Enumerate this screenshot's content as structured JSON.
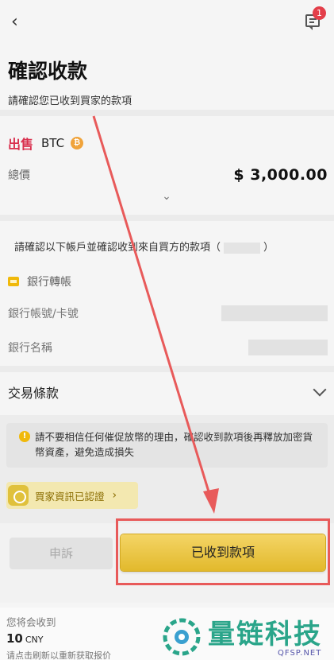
{
  "header": {
    "title": "確認收款",
    "subtitle": "請確認您已收到買家的款項",
    "notification_count": "1"
  },
  "order": {
    "side_label": "出售",
    "coin": "BTC",
    "coin_icon_glyph": "₿",
    "total_label": "總價",
    "total_value": "$ 3,000.00"
  },
  "payment": {
    "confirm_prefix": "請確認以下帳戶並確認收到來自買方的款項（",
    "confirm_suffix": "）",
    "method": "銀行轉帳",
    "fields": [
      {
        "label": "銀行帳號/卡號"
      },
      {
        "label": "銀行名稱"
      }
    ]
  },
  "terms": {
    "label": "交易條款"
  },
  "notice": {
    "text": "請不要相信任何催促放幣的理由，確認收到款項後再釋放加密貨幣資產，避免造成損失",
    "icon": "warning-icon"
  },
  "verified": {
    "label": "買家資訊已認證",
    "chevron": "›"
  },
  "actions": {
    "appeal_label": "申訴",
    "received_label": "已收到款項"
  },
  "footer": {
    "receive_label": "您将会收到",
    "receive_amount": "10",
    "receive_currency": "CNY",
    "note": "请点击刷新以重新获取报价"
  },
  "watermark": {
    "title": "量链科技",
    "subtitle": "QFSP.NET"
  },
  "colors": {
    "accent": "#f0b90b",
    "sell": "#d9304e",
    "annotation": "#e85a5a"
  }
}
